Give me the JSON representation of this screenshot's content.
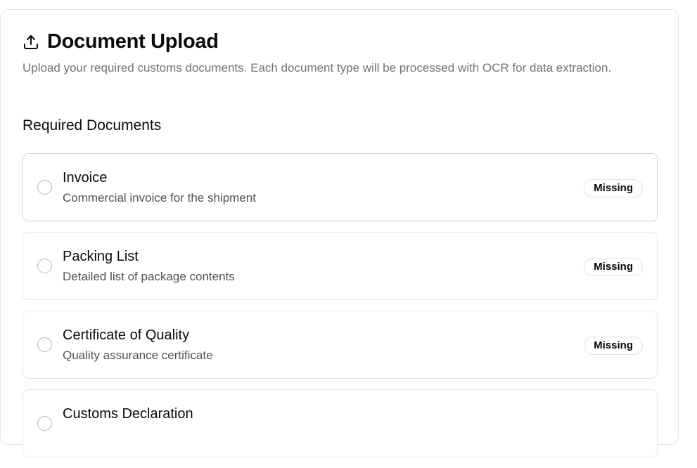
{
  "header": {
    "icon": "upload-icon",
    "title": "Document Upload",
    "description": "Upload your required customs documents. Each document type will be processed with OCR for data extraction."
  },
  "section": {
    "title": "Required Documents"
  },
  "documents": [
    {
      "name": "Invoice",
      "description": "Commercial invoice for the shipment",
      "status": "Missing"
    },
    {
      "name": "Packing List",
      "description": "Detailed list of package contents",
      "status": "Missing"
    },
    {
      "name": "Certificate of Quality",
      "description": "Quality assurance certificate",
      "status": "Missing"
    },
    {
      "name": "Customs Declaration",
      "description": "",
      "status": ""
    }
  ]
}
